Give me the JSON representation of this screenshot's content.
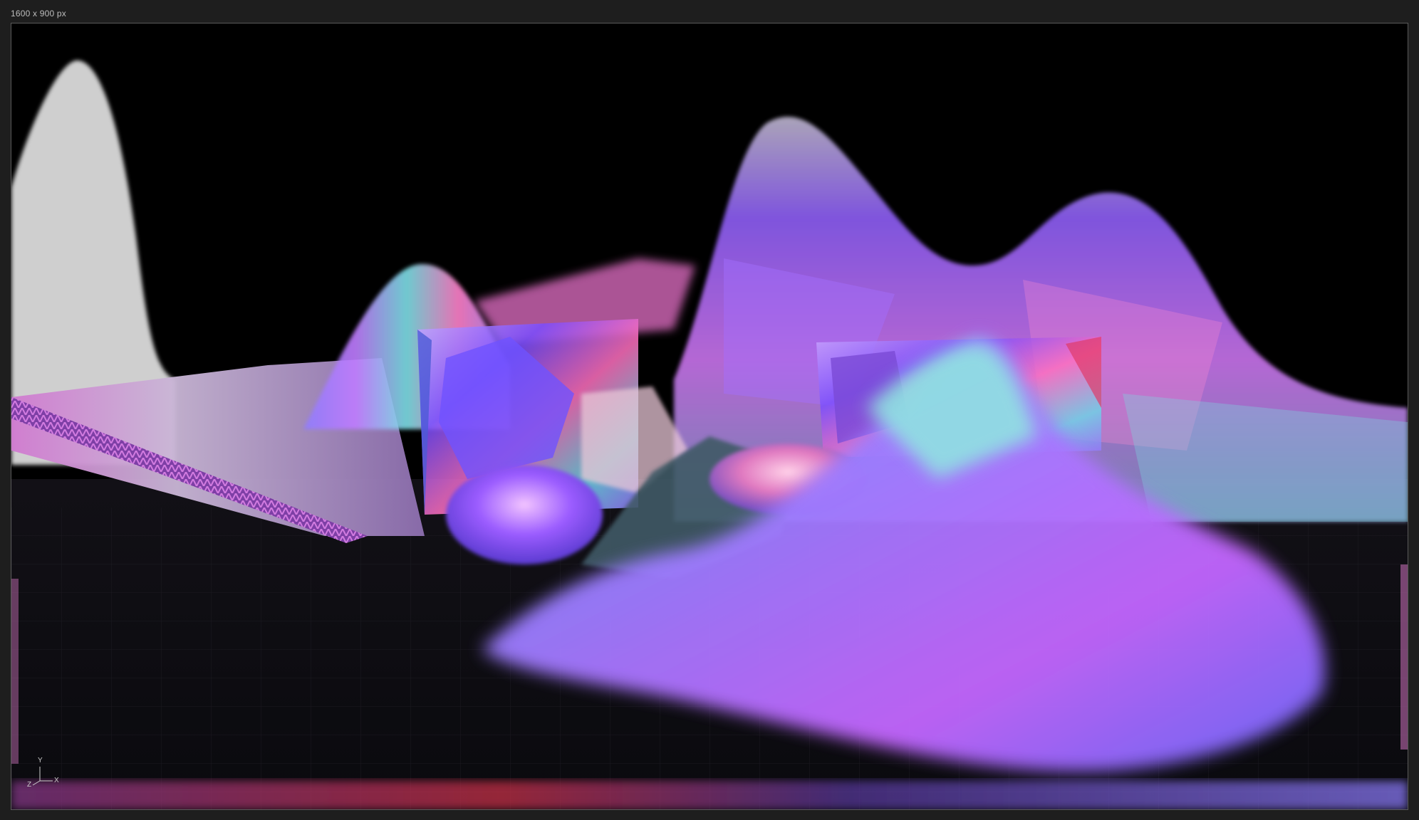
{
  "viewport": {
    "resolution_label": "1600 x 900 px"
  },
  "axis_gizmo": {
    "y_label": "Y",
    "x_label": "X",
    "z_label": "Z"
  },
  "colors": {
    "background": "#1e1e1e",
    "viewport_border": "#5a5a5a",
    "accent_purple": "#8a4dff",
    "accent_pink": "#ff5ab4",
    "accent_cyan": "#5fe0d0"
  }
}
